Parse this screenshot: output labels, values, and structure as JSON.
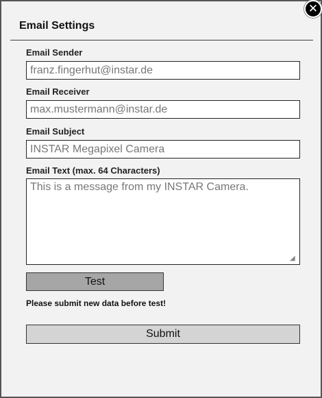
{
  "dialog": {
    "title": "Email Settings",
    "close_glyph": "✕",
    "close_icon": "close-icon"
  },
  "form": {
    "sender": {
      "label": "Email Sender",
      "value": "franz.fingerhut@instar.de"
    },
    "receiver": {
      "label": "Email Receiver",
      "value": "max.mustermann@instar.de"
    },
    "subject": {
      "label": "Email Subject",
      "value": "INSTAR Megapixel Camera"
    },
    "text": {
      "label": "Email Text (max. 64 Characters)",
      "value": "This is a message from my INSTAR Camera."
    }
  },
  "actions": {
    "test_label": "Test",
    "hint": "Please submit new data before test!",
    "submit_label": "Submit"
  },
  "colors": {
    "test_button_bg": "#a6a6a6",
    "submit_button_bg": "#d4d4d4",
    "field_text": "#777777"
  }
}
